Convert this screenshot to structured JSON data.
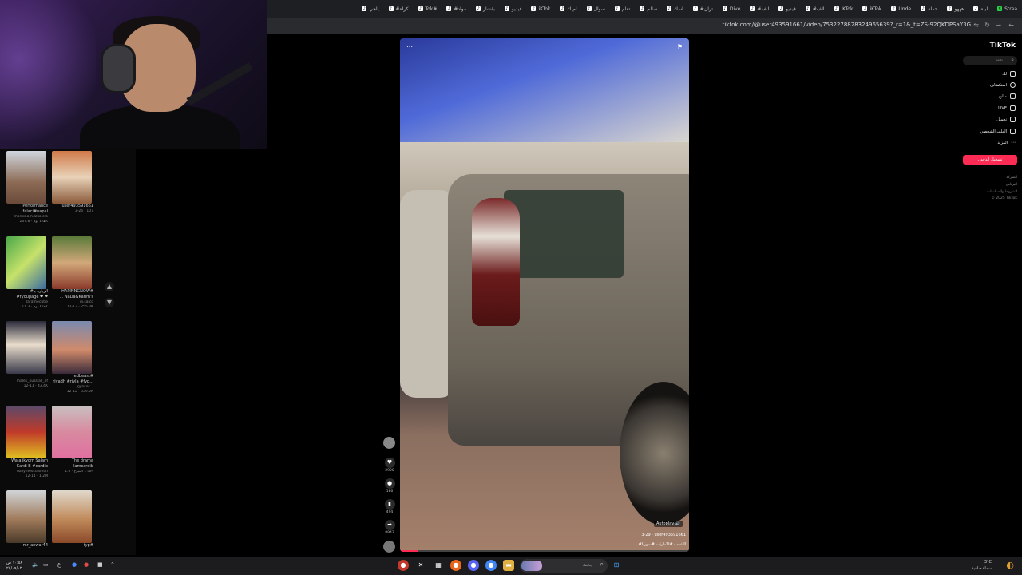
{
  "browser": {
    "tabs": [
      "Strea",
      "ليلة",
      "هههو",
      "حملة",
      "Unde",
      "iKTok",
      "iKTok",
      "#الف",
      "فيديو",
      "#الف",
      "Dive",
      "#تران",
      "اسك",
      "سالم",
      "تعلم",
      "سوال",
      "ام ك",
      "iKTok",
      "فيديو",
      "بقشار",
      "#مواد",
      "Tok#",
      "#كراه",
      "ياجي"
    ],
    "url": "tiktok.com/@user493591661/video/7532278828324965639?_r=1&_t=ZS-92QKDPSaY3G"
  },
  "left_feed": {
    "items": [
      {
        "caption": "Performance",
        "caption2": "falaci#napal",
        "meta": "monks.am.alxo.cro",
        "meta2": "ها ٤ يوم · 267.8K"
      },
      {
        "caption": "",
        "caption2": "user493591661",
        "meta": "3-26 · 107",
        "meta2": ""
      },
      {
        "caption": "#الزياره يا",
        "caption2": "#ryoupage ❤ ❤",
        "meta": "larathecutie",
        "meta2": "ها ٤ يوم · 11.3K"
      },
      {
        "caption": "HAPINNGNOW#",
        "caption2": "... NaDa&Karim's",
        "meta": "dj.salco",
        "meta2": "12-13 · 255.3K"
      },
      {
        "caption": "",
        "caption2": "",
        "meta": "malek_oussiali_of",
        "meta2": "12-11 · 43.4K"
      },
      {
        "caption": "redbeast#",
        "caption2": "riyadh #riyla #fyp...",
        "meta": "jgyosos...",
        "meta2": "12-12 · 339.2K"
      },
      {
        "caption": "Wa alikyom Salam",
        "caption2": "Cardi B #cardib",
        "meta": "dailymessfashion",
        "meta2": "12-14 · 1.2M"
      },
      {
        "caption": "The drama",
        "caption2": "lamcardib",
        "meta": "ها ٤ أسبوع · 1.6M",
        "meta2": ""
      },
      {
        "caption": "mr_anwar44",
        "caption2": "",
        "meta": "",
        "meta2": ""
      },
      {
        "caption": "fyp#",
        "caption2": "",
        "meta": "",
        "meta2": ""
      }
    ]
  },
  "video": {
    "tag": "Autoplay 🔊",
    "author": "3-29 · user493591661",
    "caption": "#الشعب #الامارات #سوريا",
    "progress_percent": 6
  },
  "actions": {
    "like": "2920",
    "comment": "186",
    "save": "494",
    "share": "8943"
  },
  "tiktok_nav": {
    "logo": "TikTok",
    "search_placeholder": "بحث",
    "items": [
      "لك",
      "استكشاف",
      "متابع",
      "LIVE",
      "تحميل",
      "الملف الشخصي",
      "المزيد"
    ],
    "login": "تسجيل الدخول",
    "footer": [
      "الشركة",
      "البرنامج",
      "الشروط والسياسات",
      "© 2025 TikTok"
    ]
  },
  "taskbar": {
    "search_placeholder": "بحث",
    "clock_time": "١٠:٥٨ ص",
    "clock_date": "٢٧/٠٩/٠٢",
    "weather_temp": "3°C",
    "weather_desc": "سماء صافية"
  },
  "colors": {
    "accent": "#fe2c55",
    "background": "#000000",
    "taskbar": "#1c1c1e"
  }
}
